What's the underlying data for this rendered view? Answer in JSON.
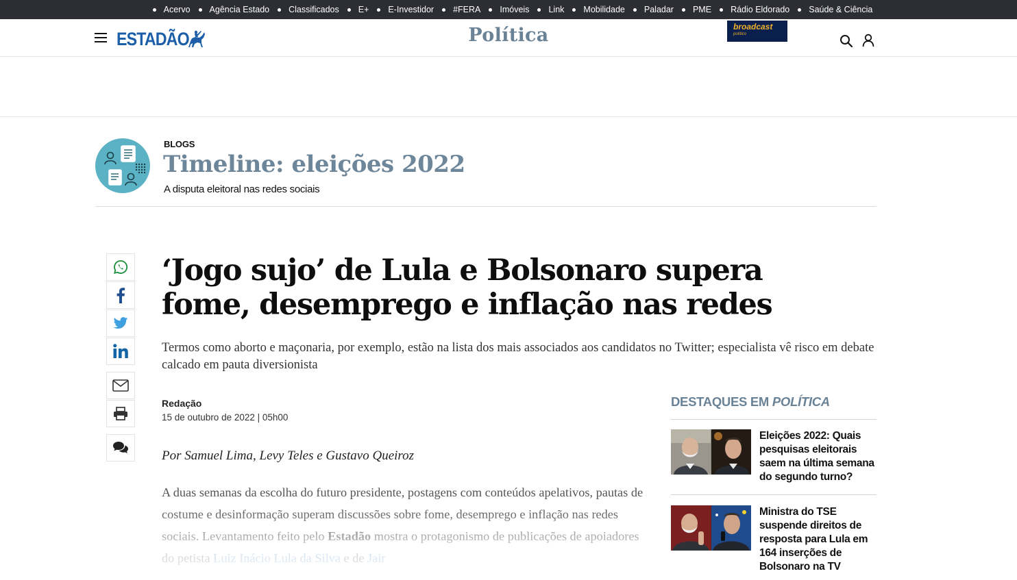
{
  "top_nav": {
    "items": [
      "Acervo",
      "Agência Estado",
      "Classificados",
      "E+",
      "E-Investidor",
      "#FERA",
      "Imóveis",
      "Link",
      "Mobilidade",
      "Paladar",
      "PME",
      "Rádio Eldorado",
      "Saúde & Ciência"
    ]
  },
  "header": {
    "logo": "ESTADÃO",
    "section": "Política",
    "broadcast": {
      "brand": "broadcast",
      "sub": "político"
    }
  },
  "icons": {
    "menu": "hamburger-menu-icon",
    "search": "search-icon",
    "user": "user-icon"
  },
  "blog": {
    "kicker": "BLOGS",
    "title": "Timeline: eleições 2022",
    "subtitle": "A disputa eleitoral nas redes sociais"
  },
  "share": [
    "whatsapp-icon",
    "facebook-icon",
    "twitter-icon",
    "linkedin-icon",
    "email-icon",
    "print-icon",
    "comments-icon"
  ],
  "article": {
    "headline": "‘Jogo sujo’ de Lula e Bolsonaro supera fome, desemprego e inflação nas redes",
    "subhead": "Termos como aborto e maçonaria, por exemplo, estão na lista dos mais associados aos candidatos no Twitter; especialista vê risco em debate calcado em pauta diversionista",
    "author": "Redação",
    "date": "15 de outubro de 2022 | 05h00",
    "by_line": "Por Samuel Lima, Levy Teles e Gustavo Queiroz",
    "body_part1": "A duas semanas da escolha do futuro presidente, postagens com conteúdos apelativos, pautas de costume e desinformação superam discussões sobre fome, desemprego e inflação nas redes sociais. Levantamento feito pelo ",
    "body_bold": "Estadão",
    "body_part2": " mostra o protagonismo de publicações de apoiadores do petista ",
    "body_link1": "Luiz Inácio Lula da Silva",
    "body_part3": " e de ",
    "body_link2": "Jair"
  },
  "sidebar": {
    "title_prefix": "DESTAQUES EM ",
    "title_section": "POLÍTICA",
    "items": [
      {
        "title": "Eleições 2022: Quais pesquisas eleitorais saem na última semana do segundo turno?"
      },
      {
        "title": "Ministra do TSE suspende direitos de resposta para Lula em 164 inserções de Bolsonaro na TV"
      }
    ]
  },
  "colors": {
    "brand_blue": "#1d5ea8",
    "section_gray_blue": "#6a8296",
    "topbar_bg": "#2d2e33",
    "link_blue": "#5b8fc4"
  }
}
